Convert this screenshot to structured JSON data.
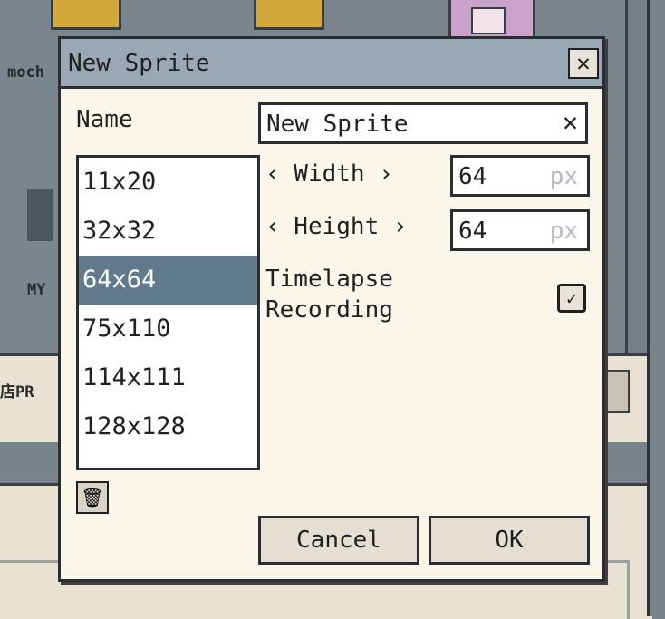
{
  "background": {
    "left_label": "moch",
    "left_label_2": "MY",
    "left_label_3": "店PR"
  },
  "dialog": {
    "title": "New Sprite",
    "name_label": "Name",
    "name_value": "New Sprite",
    "presets": [
      "11x20",
      "32x32",
      "64x64",
      "75x110",
      "114x111",
      "128x128"
    ],
    "selected_preset": "64x64",
    "width_label": "‹ Width ›",
    "width_value": "64",
    "height_label": "‹ Height ›",
    "height_value": "64",
    "unit": "px",
    "timelapse_label_1": "Timelapse",
    "timelapse_label_2": "Recording",
    "timelapse_checked": true,
    "cancel_label": "Cancel",
    "ok_label": "OK"
  },
  "colors": {
    "titlebar": "#9aa7b4",
    "dialog_bg": "#fbf6ea",
    "selection": "#627b8c"
  },
  "icons": {
    "close": "close-icon",
    "clear": "clear-icon",
    "check": "checkmark-icon",
    "trash": "trash-icon"
  }
}
